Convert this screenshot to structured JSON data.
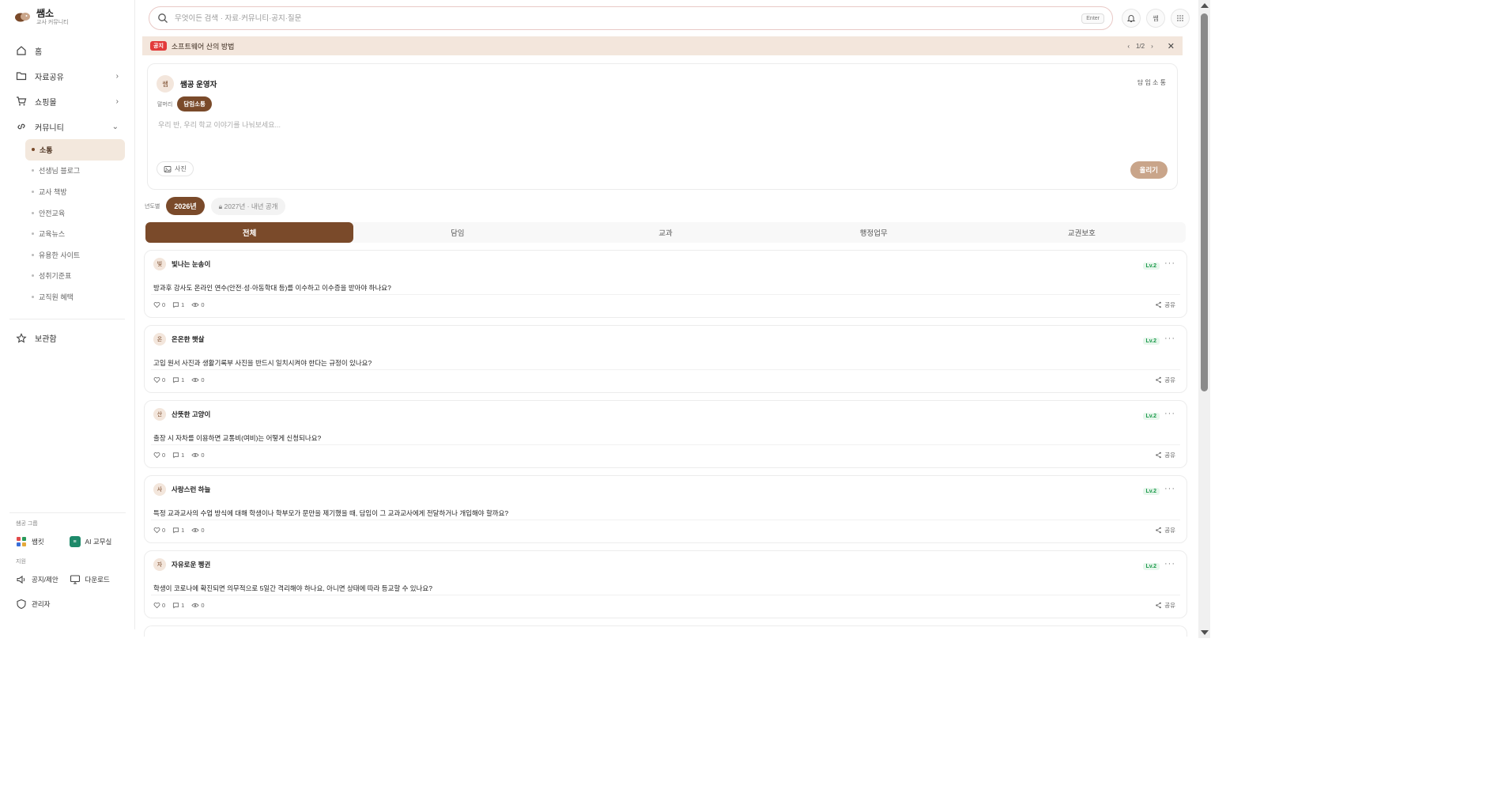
{
  "app": {
    "brand": "쌤소",
    "tagline": "교사 커뮤니티"
  },
  "sidebar": {
    "items": [
      {
        "label": "홈",
        "icon": "home-icon"
      },
      {
        "label": "자료공유",
        "icon": "folder-icon",
        "chevron": "›"
      },
      {
        "label": "쇼핑몰",
        "icon": "cart-icon",
        "chevron": "›"
      },
      {
        "label": "커뮤니티",
        "icon": "link-icon",
        "chevron": "⌄"
      }
    ],
    "community_sub": [
      {
        "label": "소통",
        "active": true
      },
      {
        "label": "선생님 블로그"
      },
      {
        "label": "교사 책방"
      },
      {
        "label": "안전교육"
      },
      {
        "label": "교육뉴스"
      },
      {
        "label": "유용한 사이트"
      },
      {
        "label": "성취기준표"
      },
      {
        "label": "교직원 혜택"
      }
    ],
    "bookmark": "보관함",
    "group_section": "쌤공 그룹",
    "groups": [
      {
        "label": "쌤킷",
        "icon": "grid-app-icon"
      },
      {
        "label": "AI 교무실",
        "icon": "ai-office-icon"
      }
    ],
    "support_section": "지원",
    "support": [
      {
        "label": "공지/제안",
        "icon": "megaphone-icon"
      },
      {
        "label": "다운로드",
        "icon": "monitor-icon"
      }
    ],
    "admin": "관리자"
  },
  "search": {
    "placeholder": "무엇이든 검색 · 자료·커뮤니티·공지·질문",
    "enter_label": "Enter"
  },
  "header_icons": {
    "avatar_label": "쌤",
    "apps_label": "⋯"
  },
  "notice": {
    "badge": "공지",
    "text": "소프트웨어 산의 방법",
    "pager": "1/2",
    "prev": "‹",
    "next": "›",
    "close": "✕"
  },
  "composer": {
    "avatar": "쌤",
    "author": "쌤공 운영자",
    "right_tag": "담 임 소 통",
    "category_label": "말머리",
    "category_active": "담임소통",
    "placeholder": "우리 반, 우리 학교 이야기를 나눠보세요...",
    "photo_label": "사진",
    "post_label": "올리기"
  },
  "years": {
    "label": "년도별",
    "active": "2026년",
    "locked": "2027년 · 내년 공개"
  },
  "tabs": [
    "전체",
    "담임",
    "교과",
    "행정업무",
    "교권보호"
  ],
  "posts": [
    {
      "avatar": "빛",
      "nick": "빛나는 눈송이",
      "level": "Lv.2",
      "body": "방과후 강사도 온라인 연수(안전·성·아동학대 등)를 이수하고 이수증을 받아야 하나요?",
      "likes": "0",
      "comments": "1",
      "views": "0",
      "share": "공유"
    },
    {
      "avatar": "온",
      "nick": "온온한 햇살",
      "level": "Lv.2",
      "body": "고입 원서 사진과 생활기록부 사진을 반드시 일치시켜야 한다는 규정이 있나요?",
      "likes": "0",
      "comments": "1",
      "views": "0",
      "share": "공유"
    },
    {
      "avatar": "산",
      "nick": "산뜻한 고양이",
      "level": "Lv.2",
      "body": "출장 시 자차를 이용하면 교통비(여비)는 어떻게 신청되나요?",
      "likes": "0",
      "comments": "1",
      "views": "0",
      "share": "공유"
    },
    {
      "avatar": "사",
      "nick": "사랑스런 하늘",
      "level": "Lv.2",
      "body": "특정 교과교사의 수업 방식에 대해 학생이나 학부모가 문만을 제기했을 때, 담임이 그 교과교사에게 전달하거나 개입해야 할까요?",
      "likes": "0",
      "comments": "1",
      "views": "0",
      "share": "공유"
    },
    {
      "avatar": "자",
      "nick": "자유로운 펭귄",
      "level": "Lv.2",
      "body": "학생이 코로나에 확진되면 의무적으로 5일간 격리해야 하나요, 아니면 상태에 따라 등교할 수 있나요?",
      "likes": "0",
      "comments": "1",
      "views": "0",
      "share": "공유"
    }
  ],
  "colors": {
    "accent": "#7a4a2a",
    "notice_bg": "#f3e6dc",
    "badge_red": "#e23b3b",
    "level_green": "#1a9a4a"
  }
}
